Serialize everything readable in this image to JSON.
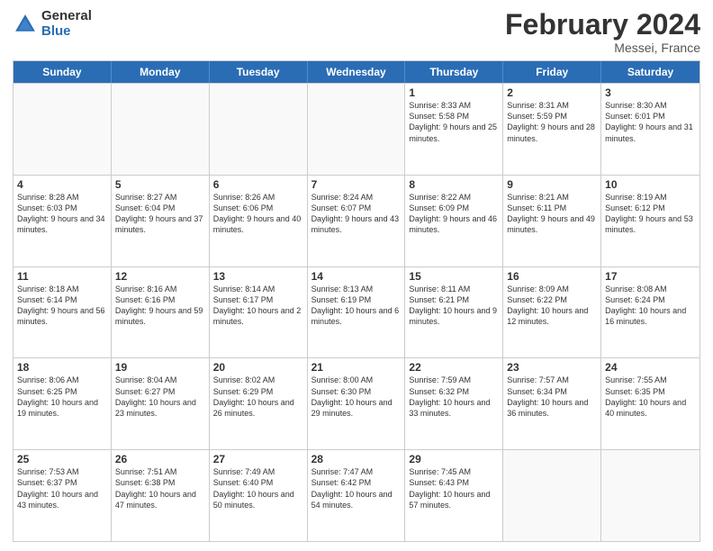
{
  "header": {
    "logo_general": "General",
    "logo_blue": "Blue",
    "title": "February 2024",
    "location": "Messei, France"
  },
  "days_of_week": [
    "Sunday",
    "Monday",
    "Tuesday",
    "Wednesday",
    "Thursday",
    "Friday",
    "Saturday"
  ],
  "weeks": [
    [
      {
        "day": "",
        "info": ""
      },
      {
        "day": "",
        "info": ""
      },
      {
        "day": "",
        "info": ""
      },
      {
        "day": "",
        "info": ""
      },
      {
        "day": "1",
        "info": "Sunrise: 8:33 AM\nSunset: 5:58 PM\nDaylight: 9 hours and 25 minutes."
      },
      {
        "day": "2",
        "info": "Sunrise: 8:31 AM\nSunset: 5:59 PM\nDaylight: 9 hours and 28 minutes."
      },
      {
        "day": "3",
        "info": "Sunrise: 8:30 AM\nSunset: 6:01 PM\nDaylight: 9 hours and 31 minutes."
      }
    ],
    [
      {
        "day": "4",
        "info": "Sunrise: 8:28 AM\nSunset: 6:03 PM\nDaylight: 9 hours and 34 minutes."
      },
      {
        "day": "5",
        "info": "Sunrise: 8:27 AM\nSunset: 6:04 PM\nDaylight: 9 hours and 37 minutes."
      },
      {
        "day": "6",
        "info": "Sunrise: 8:26 AM\nSunset: 6:06 PM\nDaylight: 9 hours and 40 minutes."
      },
      {
        "day": "7",
        "info": "Sunrise: 8:24 AM\nSunset: 6:07 PM\nDaylight: 9 hours and 43 minutes."
      },
      {
        "day": "8",
        "info": "Sunrise: 8:22 AM\nSunset: 6:09 PM\nDaylight: 9 hours and 46 minutes."
      },
      {
        "day": "9",
        "info": "Sunrise: 8:21 AM\nSunset: 6:11 PM\nDaylight: 9 hours and 49 minutes."
      },
      {
        "day": "10",
        "info": "Sunrise: 8:19 AM\nSunset: 6:12 PM\nDaylight: 9 hours and 53 minutes."
      }
    ],
    [
      {
        "day": "11",
        "info": "Sunrise: 8:18 AM\nSunset: 6:14 PM\nDaylight: 9 hours and 56 minutes."
      },
      {
        "day": "12",
        "info": "Sunrise: 8:16 AM\nSunset: 6:16 PM\nDaylight: 9 hours and 59 minutes."
      },
      {
        "day": "13",
        "info": "Sunrise: 8:14 AM\nSunset: 6:17 PM\nDaylight: 10 hours and 2 minutes."
      },
      {
        "day": "14",
        "info": "Sunrise: 8:13 AM\nSunset: 6:19 PM\nDaylight: 10 hours and 6 minutes."
      },
      {
        "day": "15",
        "info": "Sunrise: 8:11 AM\nSunset: 6:21 PM\nDaylight: 10 hours and 9 minutes."
      },
      {
        "day": "16",
        "info": "Sunrise: 8:09 AM\nSunset: 6:22 PM\nDaylight: 10 hours and 12 minutes."
      },
      {
        "day": "17",
        "info": "Sunrise: 8:08 AM\nSunset: 6:24 PM\nDaylight: 10 hours and 16 minutes."
      }
    ],
    [
      {
        "day": "18",
        "info": "Sunrise: 8:06 AM\nSunset: 6:25 PM\nDaylight: 10 hours and 19 minutes."
      },
      {
        "day": "19",
        "info": "Sunrise: 8:04 AM\nSunset: 6:27 PM\nDaylight: 10 hours and 23 minutes."
      },
      {
        "day": "20",
        "info": "Sunrise: 8:02 AM\nSunset: 6:29 PM\nDaylight: 10 hours and 26 minutes."
      },
      {
        "day": "21",
        "info": "Sunrise: 8:00 AM\nSunset: 6:30 PM\nDaylight: 10 hours and 29 minutes."
      },
      {
        "day": "22",
        "info": "Sunrise: 7:59 AM\nSunset: 6:32 PM\nDaylight: 10 hours and 33 minutes."
      },
      {
        "day": "23",
        "info": "Sunrise: 7:57 AM\nSunset: 6:34 PM\nDaylight: 10 hours and 36 minutes."
      },
      {
        "day": "24",
        "info": "Sunrise: 7:55 AM\nSunset: 6:35 PM\nDaylight: 10 hours and 40 minutes."
      }
    ],
    [
      {
        "day": "25",
        "info": "Sunrise: 7:53 AM\nSunset: 6:37 PM\nDaylight: 10 hours and 43 minutes."
      },
      {
        "day": "26",
        "info": "Sunrise: 7:51 AM\nSunset: 6:38 PM\nDaylight: 10 hours and 47 minutes."
      },
      {
        "day": "27",
        "info": "Sunrise: 7:49 AM\nSunset: 6:40 PM\nDaylight: 10 hours and 50 minutes."
      },
      {
        "day": "28",
        "info": "Sunrise: 7:47 AM\nSunset: 6:42 PM\nDaylight: 10 hours and 54 minutes."
      },
      {
        "day": "29",
        "info": "Sunrise: 7:45 AM\nSunset: 6:43 PM\nDaylight: 10 hours and 57 minutes."
      },
      {
        "day": "",
        "info": ""
      },
      {
        "day": "",
        "info": ""
      }
    ]
  ]
}
